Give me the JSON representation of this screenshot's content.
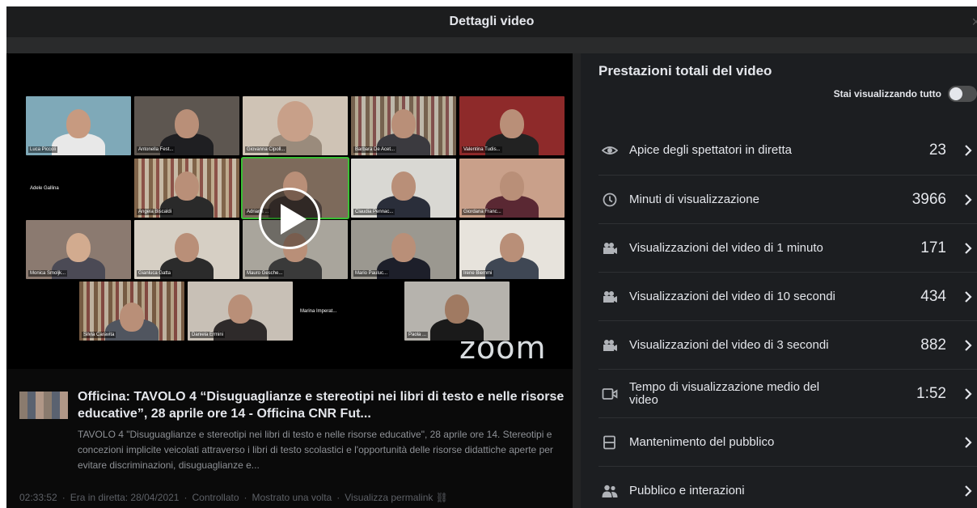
{
  "header": {
    "title": "Dettagli video",
    "close_label": "×"
  },
  "video": {
    "participants": [
      {
        "name": "Luca Piccoli"
      },
      {
        "name": "Antonella Fest..."
      },
      {
        "name": "Giovanna Cipoll..."
      },
      {
        "name": "Barbara De Acet..."
      },
      {
        "name": "Valentina Tudis..."
      },
      {
        "name": "Adele Gallina"
      },
      {
        "name": "Angela Biscaldi"
      },
      {
        "name": "Adriana ..."
      },
      {
        "name": "Claudia Pennac..."
      },
      {
        "name": "Giordana Franc..."
      },
      {
        "name": "Monica Smoljk..."
      },
      {
        "name": "Gianluca Gatta"
      },
      {
        "name": "Mauro Gesche..."
      },
      {
        "name": "Mario Pauluc..."
      },
      {
        "name": "Irene Biemmi"
      },
      {
        "name": "Silvia Caravita"
      },
      {
        "name": "Daniela Ermini"
      },
      {
        "name": "Marina Imperat..."
      },
      {
        "name": "Paola ..."
      }
    ],
    "watermark": "zoom",
    "title": "Officina: TAVOLO 4 “Disuguaglianze e stereotipi nei libri di testo e nelle risorse educative”, 28 aprile ore 14 - Officina CNR Fut...",
    "description": "TAVOLO 4 \"Disuguaglianze e stereotipi nei libri di testo e nelle risorse educative\", 28 aprile ore 14. Stereotipi e concezioni implicite veicolati attraverso i libri di testo scolastici e l'opportunità delle risorse didattiche aperte per evitare discriminazioni, disuguaglianze e...",
    "meta": {
      "duration": "02:33:52",
      "live": "Era in diretta: 28/04/2021",
      "status": "Controllato",
      "shown": "Mostrato una volta",
      "permalink": "Visualizza permalink ⛓"
    }
  },
  "performance": {
    "title": "Prestazioni totali del video",
    "toggle_label": "Stai visualizzando tutto",
    "toggle_on": false,
    "metrics": [
      {
        "icon": "eye-icon",
        "label": "Apice degli spettatori in diretta",
        "value": "23"
      },
      {
        "icon": "clock-icon",
        "label": "Minuti di visualizzazione",
        "value": "3966"
      },
      {
        "icon": "video-camera-icon",
        "label": "Visualizzazioni del video di 1 minuto",
        "value": "171"
      },
      {
        "icon": "video-camera-icon",
        "label": "Visualizzazioni del video di 10 secondi",
        "value": "434"
      },
      {
        "icon": "video-camera-icon",
        "label": "Visualizzazioni del video di 3 secondi",
        "value": "882"
      },
      {
        "icon": "video-icon",
        "label": "Tempo di visualizzazione medio del video",
        "value": "1:52"
      },
      {
        "icon": "retention-icon",
        "label": "Mantenimento del pubblico",
        "value": ""
      },
      {
        "icon": "people-icon",
        "label": "Pubblico e interazioni",
        "value": ""
      }
    ]
  }
}
